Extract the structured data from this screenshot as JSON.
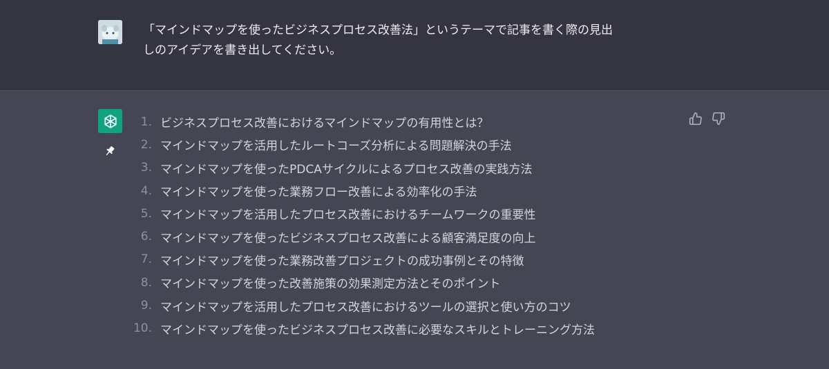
{
  "user_message": {
    "line1": "「マインドマップを使ったビジネスプロセス改善法」というテーマで記事を書く際の見出",
    "line2": "しのアイデアを書き出してください。"
  },
  "assistant_message": {
    "items": [
      {
        "num": "1.",
        "text": "ビジネスプロセス改善におけるマインドマップの有用性とは？"
      },
      {
        "num": "2.",
        "text": "マインドマップを活用したルートコーズ分析による問題解決の手法"
      },
      {
        "num": "3.",
        "text": "マインドマップを使ったPDCAサイクルによるプロセス改善の実践方法"
      },
      {
        "num": "4.",
        "text": "マインドマップを使った業務フロー改善による効率化の手法"
      },
      {
        "num": "5.",
        "text": "マインドマップを活用したプロセス改善におけるチームワークの重要性"
      },
      {
        "num": "6.",
        "text": "マインドマップを使ったビジネスプロセス改善による顧客満足度の向上"
      },
      {
        "num": "7.",
        "text": "マインドマップを使った業務改善プロジェクトの成功事例とその特徴"
      },
      {
        "num": "8.",
        "text": "マインドマップを使った改善施策の効果測定方法とそのポイント"
      },
      {
        "num": "9.",
        "text": "マインドマップを活用したプロセス改善におけるツールの選択と使い方のコツ"
      },
      {
        "num": "10.",
        "text": "マインドマップを使ったビジネスプロセス改善に必要なスキルとトレーニング方法"
      }
    ]
  },
  "icons": {
    "user_avatar": "user-avatar-icon",
    "assistant_avatar": "openai-logo-icon",
    "pin": "pin-icon",
    "thumbs_up": "thumbs-up-icon",
    "thumbs_down": "thumbs-down-icon"
  },
  "colors": {
    "user_bg": "#343541",
    "assistant_bg": "#444654",
    "assistant_avatar_bg": "#10a37f",
    "text": "#d1d5db"
  }
}
